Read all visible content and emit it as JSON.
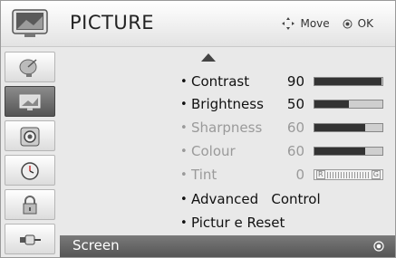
{
  "menu": {
    "title": "PICTURE",
    "hint": {
      "move_label": "Move",
      "ok_label": "OK"
    }
  },
  "sidebar": {
    "items": [
      {
        "icon": "satellite-dish-icon",
        "active": false
      },
      {
        "icon": "tv-picture-icon",
        "active": true
      },
      {
        "icon": "speaker-icon",
        "active": false
      },
      {
        "icon": "clock-icon",
        "active": false
      },
      {
        "icon": "lock-icon",
        "active": false
      },
      {
        "icon": "input-plug-icon",
        "active": false
      }
    ]
  },
  "settings": {
    "contrast": {
      "label": "Contrast",
      "value": "90",
      "level": 0.98
    },
    "brightness": {
      "label": "Brightness",
      "value": "50",
      "level": 0.5
    },
    "sharpness": {
      "label": "Sharpness",
      "value": "60",
      "level": 0.75
    },
    "colour": {
      "label": "Colour",
      "value": "60",
      "level": 0.75
    },
    "tint": {
      "label": "Tint",
      "value": "0",
      "left": "R",
      "right": "G"
    },
    "advanced": {
      "label": "Advanced   Control"
    },
    "reset": {
      "label": "Pictur e Reset"
    }
  },
  "selected": {
    "label": "Screen"
  },
  "colors": {
    "active_sidebar": "#555555",
    "bar_fill": "#333333",
    "dim_text": "#9a9a9a"
  }
}
